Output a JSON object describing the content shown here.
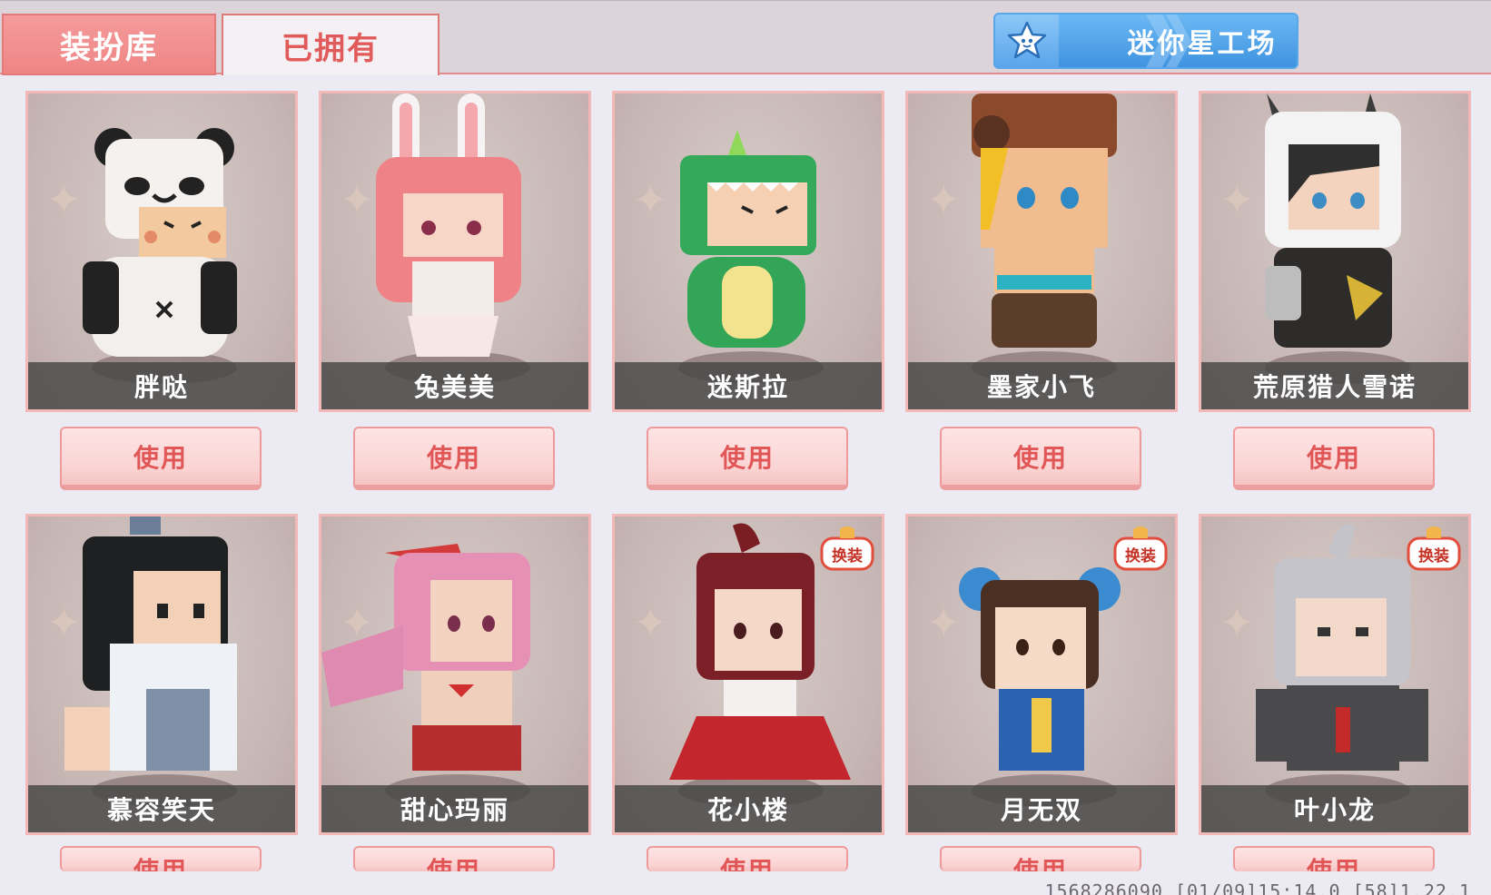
{
  "tabs": {
    "library": "装扮库",
    "owned": "已拥有"
  },
  "workshop": {
    "label": "迷你星工场",
    "icon": "star-icon"
  },
  "colors": {
    "accent": "#ef8585",
    "tab_owned_text": "#e25b5b",
    "workshop_blue": "#4a9de6",
    "use_button_bg": "#fbd4d4",
    "use_button_text": "#e15757"
  },
  "skins": [
    {
      "name": "胖哒",
      "button": "使用",
      "swap_badge": false,
      "badge_label": "",
      "icon": "panda-avatar"
    },
    {
      "name": "兔美美",
      "button": "使用",
      "swap_badge": false,
      "badge_label": "",
      "icon": "bunny-girl-avatar"
    },
    {
      "name": "迷斯拉",
      "button": "使用",
      "swap_badge": false,
      "badge_label": "",
      "icon": "dino-avatar"
    },
    {
      "name": "墨家小飞",
      "button": "使用",
      "swap_badge": false,
      "badge_label": "",
      "icon": "aviator-avatar"
    },
    {
      "name": "荒原猎人雪诺",
      "button": "使用",
      "swap_badge": false,
      "badge_label": "",
      "icon": "wolf-hunter-avatar"
    },
    {
      "name": "慕容笑天",
      "button": "使用",
      "swap_badge": false,
      "badge_label": "",
      "icon": "swordsman-avatar"
    },
    {
      "name": "甜心玛丽",
      "button": "使用",
      "swap_badge": false,
      "badge_label": "",
      "icon": "pink-hair-girl-avatar"
    },
    {
      "name": "花小楼",
      "button": "使用",
      "swap_badge": true,
      "badge_label": "换装",
      "icon": "red-dress-girl-avatar"
    },
    {
      "name": "月无双",
      "button": "使用",
      "swap_badge": true,
      "badge_label": "换装",
      "icon": "blue-bun-girl-avatar"
    },
    {
      "name": "叶小龙",
      "button": "使用",
      "swap_badge": true,
      "badge_label": "换装",
      "icon": "silver-hair-boy-avatar"
    }
  ],
  "debug": "1568286090  [01/09]15:14.0  [58]1.22.1"
}
